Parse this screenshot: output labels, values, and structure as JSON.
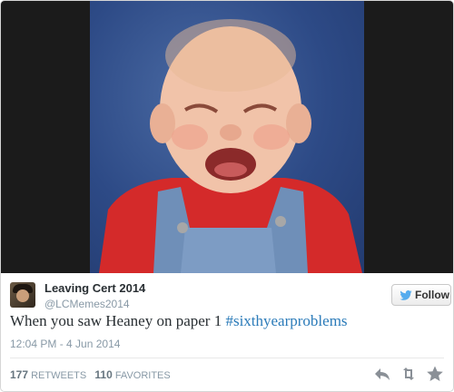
{
  "tweet": {
    "author_name": "Leaving Cert 2014",
    "author_handle": "@LCMemes2014",
    "follow_label": "Follow",
    "text_main": "When you saw Heaney on paper 1 ",
    "hashtag": "#sixthyearproblems",
    "timestamp": "12:04 PM - 4 Jun 2014",
    "retweets_count": "177",
    "retweets_label": "RETWEETS",
    "favorites_count": "110",
    "favorites_label": "FAVORITES"
  },
  "icons": {
    "follow": "twitter-bird-icon",
    "reply": "reply-icon",
    "retweet": "retweet-icon",
    "favorite": "star-icon"
  },
  "colors": {
    "hashtag": "#2b7bb9",
    "twitter_blue": "#55acee",
    "muted": "#8899a6",
    "action_gray": "#8a9097"
  }
}
